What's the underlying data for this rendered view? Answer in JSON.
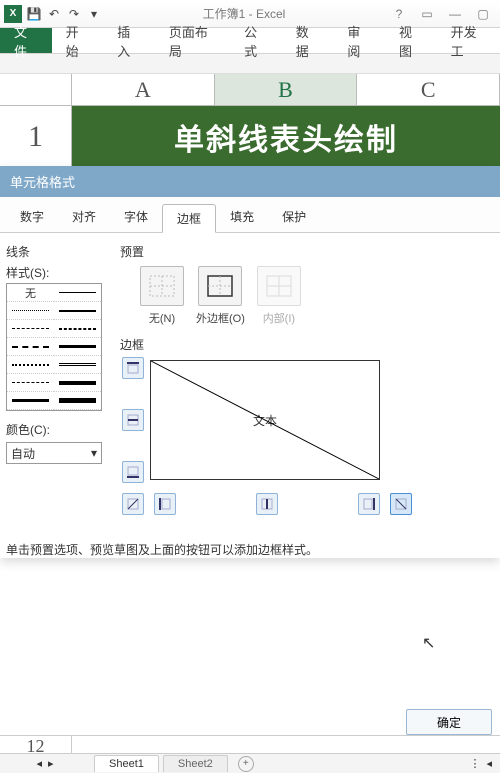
{
  "window": {
    "title": "工作簿1 - Excel",
    "help_tip": "?"
  },
  "qat": {
    "save_icon": "save-icon",
    "undo_icon": "undo-icon",
    "redo_icon": "redo-icon"
  },
  "ribbon": {
    "file": "文件",
    "tabs": [
      "开始",
      "插入",
      "页面布局",
      "公式",
      "数据",
      "审阅",
      "视图",
      "开发工"
    ]
  },
  "grid": {
    "columns": [
      "A",
      "B",
      "C"
    ],
    "selected_column_index": 1,
    "row1_number": "1",
    "merged_text": "单斜线表头绘制",
    "row12_number": "12"
  },
  "dialog": {
    "title": "单元格格式",
    "tabs": [
      "数字",
      "对齐",
      "字体",
      "边框",
      "填充",
      "保护"
    ],
    "active_tab_index": 3,
    "line_group": "线条",
    "style_label": "样式(S):",
    "style_none": "无",
    "color_label": "颜色(C):",
    "color_value": "自动",
    "preset_group": "预置",
    "presets": [
      {
        "label": "无(N)"
      },
      {
        "label": "外边框(O)"
      },
      {
        "label": "内部(I)"
      }
    ],
    "border_group": "边框",
    "preview_text": "文本",
    "help_text": "单击预置选项、预览草图及上面的按钮可以添加边框样式。",
    "ok": "确定"
  },
  "sheets": {
    "tabs": [
      "Sheet1",
      "Sheet2"
    ],
    "active_index": 0,
    "add": "+"
  }
}
